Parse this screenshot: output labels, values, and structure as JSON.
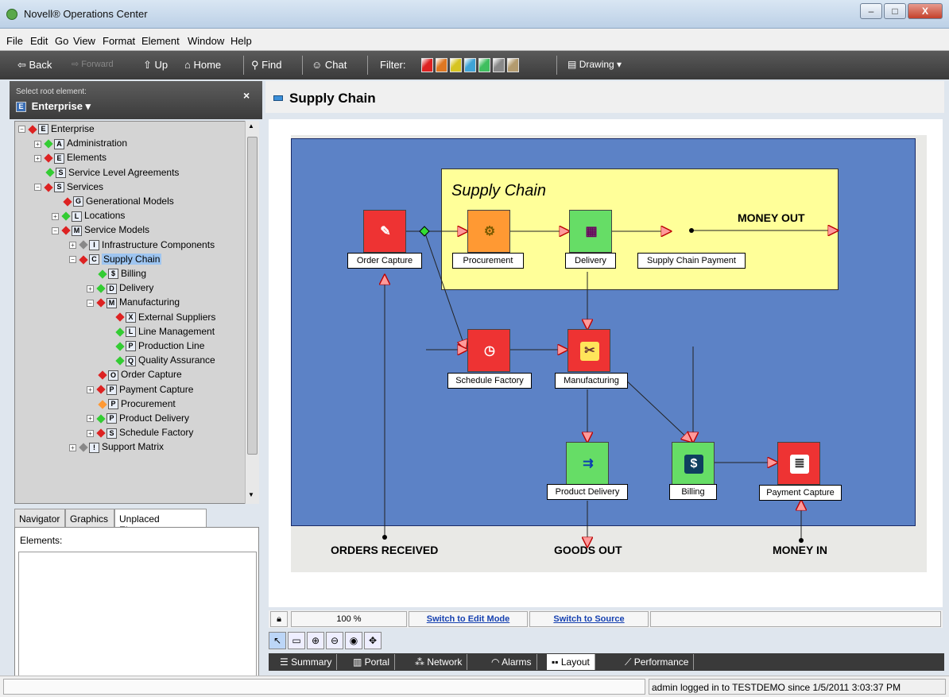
{
  "window": {
    "title": "Novell® Operations Center"
  },
  "menu": [
    "File",
    "Edit",
    "Go",
    "View",
    "Format",
    "Element",
    "Window",
    "Help"
  ],
  "toolbar": {
    "back": "Back",
    "forward": "Forward",
    "up": "Up",
    "home": "Home",
    "find": "Find",
    "chat": "Chat",
    "filter": "Filter:",
    "drawing": "Drawing",
    "filter_colors": [
      "#dd2222",
      "#dd7722",
      "#d6c422",
      "#3fa3d6",
      "#3fbf5f",
      "#888888",
      "#b39b6e"
    ]
  },
  "left": {
    "root_label": "Select root element:",
    "root_value": "Enterprise",
    "tree": [
      {
        "label": "Enterprise",
        "icon": "E",
        "status": "#dd2222"
      },
      {
        "label": "Administration",
        "icon": "A",
        "status": "#33cc33"
      },
      {
        "label": "Elements",
        "icon": "E",
        "status": "#dd2222"
      },
      {
        "label": "Service Level Agreements",
        "icon": "S",
        "status": "#33cc33"
      },
      {
        "label": "Services",
        "icon": "S",
        "status": "#dd2222"
      },
      {
        "label": "Generational Models",
        "icon": "G",
        "status": "#dd2222"
      },
      {
        "label": "Locations",
        "icon": "L",
        "status": "#33cc33"
      },
      {
        "label": "Service Models",
        "icon": "M",
        "status": "#dd2222"
      },
      {
        "label": "Infrastructure Components",
        "icon": "I",
        "status": "#888888"
      },
      {
        "label": "Supply Chain",
        "icon": "C",
        "status": "#dd2222"
      },
      {
        "label": "Billing",
        "icon": "$",
        "status": "#33cc33"
      },
      {
        "label": "Delivery",
        "icon": "D",
        "status": "#33cc33"
      },
      {
        "label": "Manufacturing",
        "icon": "M",
        "status": "#dd2222"
      },
      {
        "label": "External Suppliers",
        "icon": "X",
        "status": "#dd2222"
      },
      {
        "label": "Line Management",
        "icon": "L",
        "status": "#33cc33"
      },
      {
        "label": "Production Line",
        "icon": "P",
        "status": "#33cc33"
      },
      {
        "label": "Quality Assurance",
        "icon": "Q",
        "status": "#33cc33"
      },
      {
        "label": "Order Capture",
        "icon": "O",
        "status": "#dd2222"
      },
      {
        "label": "Payment Capture",
        "icon": "P",
        "status": "#dd2222"
      },
      {
        "label": "Procurement",
        "icon": "P",
        "status": "#ff9933"
      },
      {
        "label": "Product Delivery",
        "icon": "P",
        "status": "#33cc33"
      },
      {
        "label": "Schedule Factory",
        "icon": "S",
        "status": "#dd2222"
      },
      {
        "label": "Support Matrix",
        "icon": "!",
        "status": "#888888"
      }
    ],
    "tabs": [
      "Navigator",
      "Graphics",
      "Unplaced Elements"
    ],
    "elements_label": "Elements:"
  },
  "right": {
    "title": "Supply Chain",
    "diagram": {
      "group_title": "Supply Chain",
      "nodes": {
        "order_capture": "Order Capture",
        "procurement": "Procurement",
        "delivery": "Delivery",
        "supply_payment": "Supply Chain Payment",
        "schedule_factory": "Schedule Factory",
        "manufacturing": "Manufacturing",
        "product_delivery": "Product Delivery",
        "billing": "Billing",
        "payment_capture": "Payment Capture"
      },
      "externals": {
        "money_out": "MONEY OUT",
        "orders_received": "ORDERS RECEIVED",
        "goods_out": "GOODS OUT",
        "money_in": "MONEY IN"
      }
    },
    "zoom": "100 %",
    "edit_mode": "Switch to Edit Mode",
    "source": "Switch to Source",
    "view_tabs": [
      "Summary",
      "Portal",
      "Network",
      "Alarms",
      "Layout",
      "Performance"
    ]
  },
  "status": "admin logged in to TESTDEMO since 1/5/2011 3:03:37 PM"
}
